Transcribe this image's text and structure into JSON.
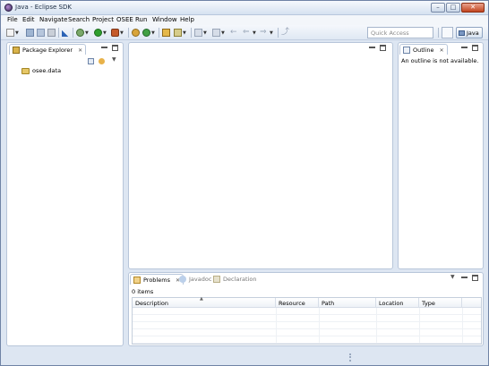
{
  "window": {
    "title": "Java - Eclipse SDK",
    "buttons": {
      "minimize": "–",
      "maximize": "□",
      "close": "✕"
    }
  },
  "menu": [
    "File",
    "Edit",
    "Navigate",
    "Search",
    "Project",
    "OSEE",
    "Run",
    "Window",
    "Help"
  ],
  "toolbar": {
    "quick_access_placeholder": "Quick Access",
    "perspective_label": "Java",
    "icons": [
      "new-icon",
      "save-icon",
      "save-all-icon",
      "print-icon",
      "pin-icon",
      "debug-icon",
      "run-icon",
      "external-tools-icon",
      "new-java-project-icon",
      "new-package-icon",
      "new-class-icon",
      "open-type-icon",
      "search-icon",
      "prev-annotation-icon",
      "next-annotation-icon",
      "back-icon",
      "forward-icon",
      "pin-editor-icon",
      "open-perspective-icon"
    ]
  },
  "package_explorer": {
    "tab_label": "Package Explorer",
    "tree": [
      {
        "label": "osee.data",
        "icon": "project-folder-icon"
      }
    ]
  },
  "outline": {
    "tab_label": "Outline",
    "message": "An outline is not available."
  },
  "bottom_panel": {
    "tabs": [
      {
        "label": "Problems",
        "active": true
      },
      {
        "label": "Javadoc",
        "active": false
      },
      {
        "label": "Declaration",
        "active": false
      }
    ],
    "items_count": "0 items",
    "columns": [
      "Description",
      "Resource",
      "Path",
      "Location",
      "Type"
    ],
    "sort_indicator": "▲"
  },
  "colors": {
    "frame": "#dde6f2",
    "panel_border": "#b8c6da",
    "accent": "#3d5c8a"
  }
}
